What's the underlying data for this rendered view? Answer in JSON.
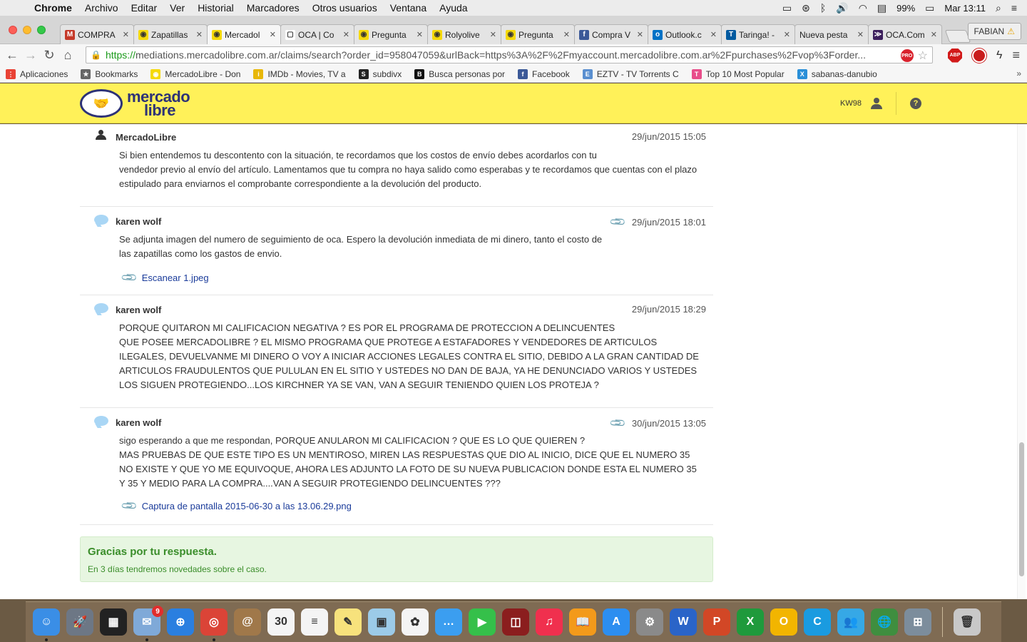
{
  "menubar": {
    "app": "Chrome",
    "items": [
      "Archivo",
      "Editar",
      "Ver",
      "Historial",
      "Marcadores",
      "Otros usuarios",
      "Ventana",
      "Ayuda"
    ],
    "battery": "99%",
    "clock": "Mar 13:11"
  },
  "tabs": [
    {
      "label": "COMPRA",
      "icon": "gmail-icon",
      "color": "#c53929",
      "glyph": "M"
    },
    {
      "label": "Zapatillas",
      "icon": "mercadolibre-icon",
      "color": "#f5d90a",
      "glyph": "◉"
    },
    {
      "label": "Mercadol",
      "icon": "mercadolibre-icon",
      "color": "#f5d90a",
      "glyph": "◉"
    },
    {
      "label": "OCA | Co",
      "icon": "page-icon",
      "color": "#ffffff",
      "glyph": "▢"
    },
    {
      "label": "Pregunta",
      "icon": "mercadolibre-icon",
      "color": "#f5d90a",
      "glyph": "◉"
    },
    {
      "label": "Rolyolive",
      "icon": "mercadolibre-icon",
      "color": "#f5d90a",
      "glyph": "◉"
    },
    {
      "label": "Pregunta",
      "icon": "mercadolibre-icon",
      "color": "#f5d90a",
      "glyph": "◉"
    },
    {
      "label": "Compra V",
      "icon": "facebook-icon",
      "color": "#3b5998",
      "glyph": "f"
    },
    {
      "label": "Outlook.c",
      "icon": "outlook-icon",
      "color": "#0072c6",
      "glyph": "o"
    },
    {
      "label": "Taringa! -",
      "icon": "taringa-icon",
      "color": "#005aa0",
      "glyph": "T"
    },
    {
      "label": "Nueva pesta",
      "icon": "",
      "color": "",
      "glyph": ""
    },
    {
      "label": "OCA.Com",
      "icon": "oca-icon",
      "color": "#3c1f5c",
      "glyph": "≫"
    }
  ],
  "profile": {
    "name": "FABIAN"
  },
  "address": {
    "scheme": "https://",
    "rest": "mediations.mercadolibre.com.ar/claims/search?order_id=958047059&urlBack=https%3A%2F%2Fmyaccount.mercadolibre.com.ar%2Fpurchases%2Fvop%3Forder..."
  },
  "bookmarks": [
    {
      "label": "Aplicaciones",
      "icon": "apps-grid-icon",
      "color": "#e94235",
      "glyph": "⋮"
    },
    {
      "label": "Bookmarks",
      "icon": "star-icon",
      "color": "#666666",
      "glyph": "★"
    },
    {
      "label": "MercadoLibre - Don",
      "icon": "mercadolibre-icon",
      "color": "#f5d90a",
      "glyph": "◉"
    },
    {
      "label": "IMDb - Movies, TV a",
      "icon": "imdb-icon",
      "color": "#e8b708",
      "glyph": "i"
    },
    {
      "label": "subdivx",
      "icon": "subdivx-icon",
      "color": "#222222",
      "glyph": "S"
    },
    {
      "label": "Busca personas por",
      "icon": "busca-icon",
      "color": "#111111",
      "glyph": "B"
    },
    {
      "label": "Facebook",
      "icon": "facebook-icon",
      "color": "#3b5998",
      "glyph": "f"
    },
    {
      "label": "EZTV - TV Torrents C",
      "icon": "eztv-icon",
      "color": "#5a8fd0",
      "glyph": "E"
    },
    {
      "label": "Top 10 Most Popular",
      "icon": "tf-icon",
      "color": "#e84d8a",
      "glyph": "T"
    },
    {
      "label": "sabanas-danubio",
      "icon": "x-icon",
      "color": "#2a8fd8",
      "glyph": "X"
    }
  ],
  "ml": {
    "logo_line1": "mercado",
    "logo_line2": "libre",
    "user": "KW98",
    "help": "?"
  },
  "messages": [
    {
      "author": "MercadoLibre",
      "date": "29/jun/2015 15:05",
      "lines": [
        "Si bien entendemos tu descontento con la situación, te recordamos que los costos de envío debes acordarlos con tu",
        "vendedor previo al envío del artículo. Lamentamos que tu compra no haya salido como esperabas y te recordamos que cuentas con el plazo",
        "estipulado para enviarnos el comprobante correspondiente a la devolución del producto."
      ]
    },
    {
      "author": "karen wolf",
      "date": "29/jun/2015 18:01",
      "lines": [
        "Se adjunta imagen del numero de seguimiento de oca. Espero la devolución inmediata de mi dinero, tanto el costo de",
        "las zapatillas como los gastos de envio."
      ],
      "attachment": "Escanear 1.jpeg"
    },
    {
      "author": "karen wolf",
      "date": "29/jun/2015 18:29",
      "lines": [
        "PORQUE QUITARON MI CALIFICACION NEGATIVA ? ES POR EL PROGRAMA DE PROTECCION A DELINCUENTES",
        "QUE POSEE MERCADOLIBRE ? EL MISMO PROGRAMA QUE PROTEGE A ESTAFADORES Y VENDEDORES DE ARTICULOS",
        "ILEGALES, DEVUELVANME MI DINERO O VOY A INICIAR ACCIONES LEGALES CONTRA EL SITIO, DEBIDO A LA GRAN CANTIDAD DE",
        "ARTICULOS FRAUDULENTOS QUE PULULAN EN EL SITIO Y USTEDES NO DAN DE BAJA, YA HE DENUNCIADO VARIOS Y USTEDES",
        "LOS SIGUEN PROTEGIENDO...LOS KIRCHNER YA SE VAN, VAN A SEGUIR TENIENDO QUIEN LOS PROTEJA ?"
      ]
    },
    {
      "author": "karen wolf",
      "date": "30/jun/2015 13:05",
      "lines": [
        "sigo esperando a que me respondan, PORQUE ANULARON MI CALIFICACION ? QUE ES LO QUE QUIEREN ?",
        "MAS PRUEBAS DE QUE ESTE TIPO ES UN MENTIROSO, MIREN LAS RESPUESTAS QUE DIO AL INICIO, DICE QUE EL NUMERO 35",
        "NO EXISTE Y QUE YO ME EQUIVOQUE, AHORA LES ADJUNTO LA FOTO DE SU NUEVA PUBLICACION DONDE ESTA EL NUMERO 35",
        "Y 35 Y MEDIO PARA LA COMPRA....VAN A SEGUIR PROTEGIENDO DELINCUENTES ???"
      ],
      "attachment": "Captura de pantalla 2015-06-30 a las 13.06.29.png"
    }
  ],
  "notice": {
    "title": "Gracias por tu respuesta.",
    "detail": "En 3 días tendremos novedades sobre el caso."
  },
  "dock": [
    {
      "name": "finder-icon",
      "color": "#3a8ee6",
      "glyph": "☺",
      "running": true
    },
    {
      "name": "launchpad-icon",
      "color": "#6d7785",
      "glyph": "🚀",
      "running": false
    },
    {
      "name": "activity-monitor-icon",
      "color": "#222222",
      "glyph": "▦",
      "running": false
    },
    {
      "name": "mail-icon",
      "color": "#7fa9d8",
      "glyph": "✉",
      "running": true,
      "badge": "9"
    },
    {
      "name": "safari-icon",
      "color": "#2a7fe0",
      "glyph": "⊕",
      "running": false
    },
    {
      "name": "chrome-icon",
      "color": "#db4437",
      "glyph": "◎",
      "running": true
    },
    {
      "name": "contacts-icon",
      "color": "#a0784a",
      "glyph": "@",
      "running": false
    },
    {
      "name": "calendar-icon",
      "color": "#f4f4f4",
      "glyph": "30",
      "running": false
    },
    {
      "name": "reminders-icon",
      "color": "#f4f4f4",
      "glyph": "≡",
      "running": false
    },
    {
      "name": "notes-icon",
      "color": "#f7e27c",
      "glyph": "✎",
      "running": false
    },
    {
      "name": "preview-icon",
      "color": "#9ccbe8",
      "glyph": "▣",
      "running": false
    },
    {
      "name": "photos-icon",
      "color": "#f4f4f4",
      "glyph": "✿",
      "running": false
    },
    {
      "name": "messages-icon",
      "color": "#3b9ef0",
      "glyph": "…",
      "running": false
    },
    {
      "name": "facetime-icon",
      "color": "#35c04a",
      "glyph": "▶",
      "running": false
    },
    {
      "name": "photo-booth-icon",
      "color": "#8b1e1e",
      "glyph": "◫",
      "running": false
    },
    {
      "name": "itunes-icon",
      "color": "#f0304e",
      "glyph": "♫",
      "running": false
    },
    {
      "name": "ibooks-icon",
      "color": "#f39a1b",
      "glyph": "📖",
      "running": false
    },
    {
      "name": "app-store-icon",
      "color": "#2c8ef0",
      "glyph": "A",
      "running": false
    },
    {
      "name": "system-preferences-icon",
      "color": "#8a8a8a",
      "glyph": "⚙",
      "running": false
    },
    {
      "name": "word-icon",
      "color": "#2a64c8",
      "glyph": "W",
      "running": false
    },
    {
      "name": "powerpoint-icon",
      "color": "#d24726",
      "glyph": "P",
      "running": false
    },
    {
      "name": "excel-icon",
      "color": "#1f9a3c",
      "glyph": "X",
      "running": false
    },
    {
      "name": "outlook-icon",
      "color": "#f2b500",
      "glyph": "O",
      "running": false
    },
    {
      "name": "skype-icon",
      "color": "#1a9be0",
      "glyph": "C",
      "running": false
    },
    {
      "name": "messenger-icon",
      "color": "#36a8e6",
      "glyph": "👥",
      "running": false
    },
    {
      "name": "network-icon",
      "color": "#3f8e3f",
      "glyph": "🌐",
      "running": false
    },
    {
      "name": "remote-desktop-icon",
      "color": "#7c8d9c",
      "glyph": "⊞",
      "running": false
    },
    {
      "name": "trash-icon",
      "color": "#c8c8c8",
      "glyph": "🗑",
      "running": false
    }
  ]
}
